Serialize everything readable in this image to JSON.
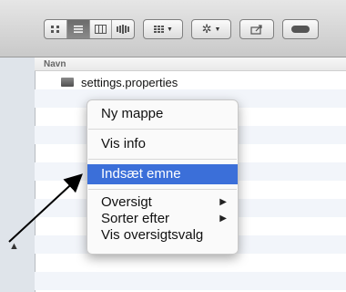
{
  "header": {
    "column_name": "Navn"
  },
  "file": {
    "name": "settings.properties"
  },
  "toolbar": {
    "view_modes": [
      "icon-view",
      "list-view",
      "column-view",
      "coverflow-view"
    ],
    "arrange_icon": "arrange-icon",
    "action_icon": "gear-icon",
    "share_icon": "share-icon",
    "toggle_icon": "toolbar-toggle-icon"
  },
  "menu": {
    "new_folder": "Ny mappe",
    "info": "Vis info",
    "paste": "Indsæt emne",
    "overview": "Oversigt",
    "sort_by": "Sorter efter",
    "view_options": "Vis oversigtsvalg"
  },
  "colors": {
    "highlight": "#3b6fd9"
  }
}
